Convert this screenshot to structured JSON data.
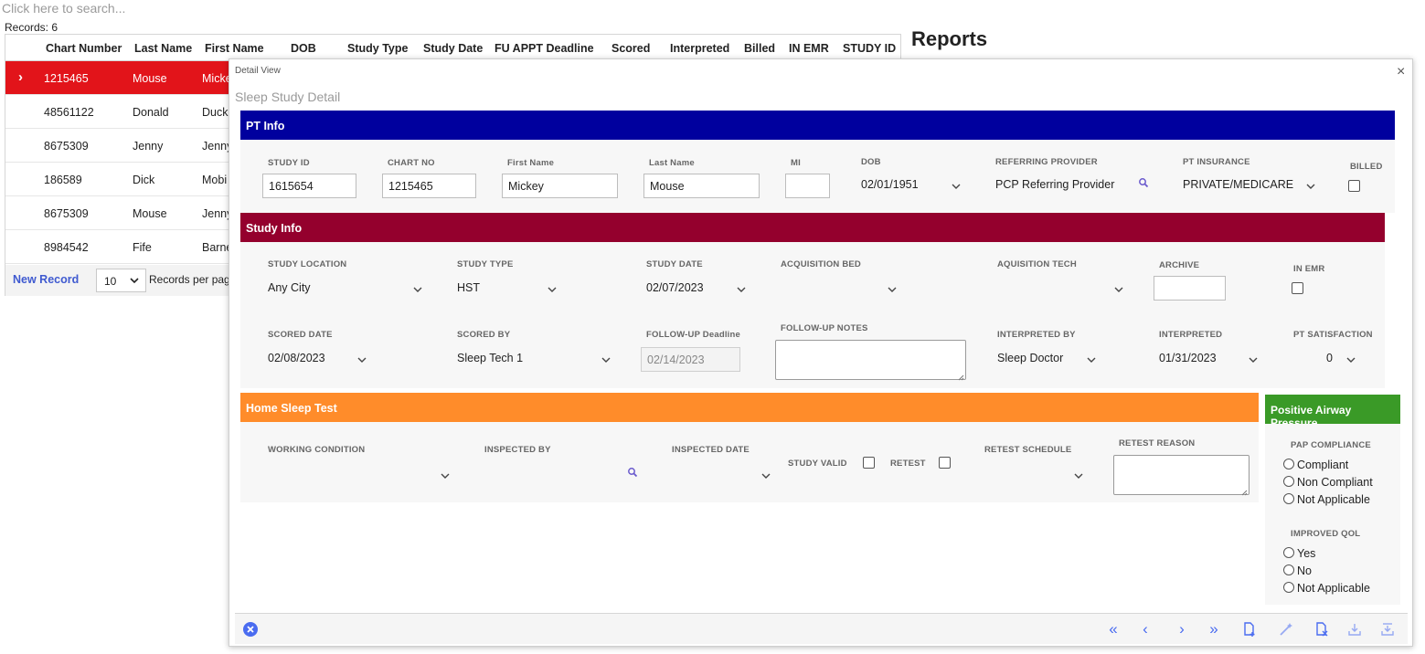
{
  "search": {
    "placeholder": "Click here to search..."
  },
  "records": {
    "label": "Records:",
    "count": "6"
  },
  "reports": {
    "title": "Reports"
  },
  "grid": {
    "columns": [
      "Chart Number",
      "Last Name",
      "First Name",
      "DOB",
      "Study Type",
      "Study Date",
      "FU APPT Deadline",
      "Scored",
      "Interpreted",
      "Billed",
      "IN EMR",
      "STUDY ID"
    ],
    "rows": [
      {
        "chart": "1215465",
        "last": "Mouse",
        "first": "Micke"
      },
      {
        "chart": "48561122",
        "last": "Donald",
        "first": "Duck"
      },
      {
        "chart": "8675309",
        "last": "Jenny",
        "first": "Jenny"
      },
      {
        "chart": "186589",
        "last": "Dick",
        "first": "Mobi"
      },
      {
        "chart": "8675309",
        "last": "Mouse",
        "first": "Jenny"
      },
      {
        "chart": "8984542",
        "last": "Fife",
        "first": "Barne"
      }
    ],
    "selected_arrow": "›",
    "footer": {
      "new_record": "New Record",
      "page_size": "10",
      "per_page_label": "Records per pag"
    }
  },
  "modal": {
    "caption": "Detail View",
    "close": "×",
    "subtitle": "Sleep Study Detail",
    "pt_info": {
      "title": "PT Info",
      "color": "#00009e",
      "study_id_label": "STUDY ID",
      "study_id": "1615654",
      "chart_no_label": "CHART NO",
      "chart_no": "1215465",
      "first_name_label": "First Name",
      "first_name": "Mickey",
      "last_name_label": "Last Name",
      "last_name": "Mouse",
      "mi_label": "MI",
      "mi": "",
      "dob_label": "DOB",
      "dob": "02/01/1951",
      "referring_label": "REFERRING PROVIDER",
      "referring": "PCP Referring Provider",
      "insurance_label": "PT INSURANCE",
      "insurance": "PRIVATE/MEDICARE",
      "billed_label": "BILLED"
    },
    "study_info": {
      "title": "Study Info",
      "color": "#94002d",
      "location_label": "STUDY LOCATION",
      "location": "Any City",
      "type_label": "STUDY TYPE",
      "type": "HST",
      "date_label": "STUDY DATE",
      "date": "02/07/2023",
      "bed_label": "ACQUISITION BED",
      "bed": "",
      "tech_label": "AQUISITION TECH",
      "tech": "",
      "archive_label": "ARCHIVE",
      "in_emr_label": "IN EMR",
      "scored_date_label": "SCORED DATE",
      "scored_date": "02/08/2023",
      "scored_by_label": "SCORED BY",
      "scored_by": "Sleep Tech 1",
      "followup_deadline_label": "FOLLOW-UP Deadline",
      "followup_deadline": "02/14/2023",
      "followup_notes_label": "FOLLOW-UP NOTES",
      "interpreted_by_label": "INTERPRETED BY",
      "interpreted_by": "Sleep Doctor",
      "interpreted_label": "INTERPRETED",
      "interpreted": "01/31/2023",
      "satisfaction_label": "PT SATISFACTION",
      "satisfaction": "0"
    },
    "home_sleep_test": {
      "title": "Home Sleep Test",
      "color": "#ff8c2a",
      "working_condition_label": "WORKING CONDITION",
      "inspected_by_label": "INSPECTED BY",
      "inspected_date_label": "INSPECTED DATE",
      "study_valid_label": "STUDY VALID",
      "retest_label": "RETEST",
      "retest_schedule_label": "RETEST SCHEDULE",
      "retest_reason_label": "RETEST REASON"
    },
    "pap": {
      "title": "Positive Airway Pressure",
      "color": "#3a9a27",
      "compliance_label": "PAP COMPLIANCE",
      "compliance_options": [
        "Compliant",
        "Non Compliant",
        "Not Applicable"
      ],
      "qol_label": "IMPROVED QOL",
      "qol_options": [
        "Yes",
        "No",
        "Not Applicable"
      ]
    },
    "footer": {
      "cancel_icon": "x-circle-icon",
      "first_icon": "«",
      "prev_icon": "‹",
      "next_icon": "›",
      "last_icon": "»",
      "icon_color": "#4a6cf0"
    }
  }
}
